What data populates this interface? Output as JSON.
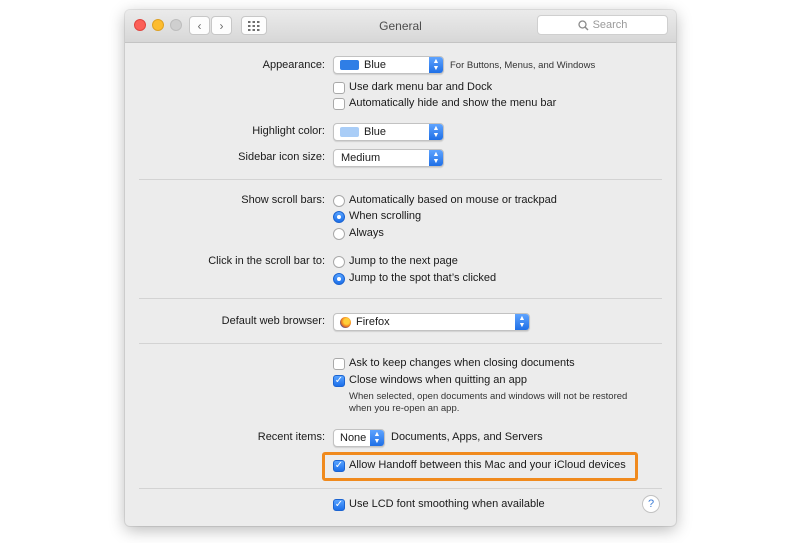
{
  "window": {
    "title": "General"
  },
  "toolbar": {
    "back_glyph": "‹",
    "forward_glyph": "›",
    "grid_glyph": "⋮⋮⋮"
  },
  "search": {
    "placeholder": "Search",
    "icon": "search-icon"
  },
  "appearance": {
    "label": "Appearance:",
    "value": "Blue",
    "note": "For Buttons, Menus, and Windows",
    "swatch_color": "#2f7ee6",
    "dark_menu": {
      "label": "Use dark menu bar and Dock",
      "checked": false
    },
    "auto_hide": {
      "label": "Automatically hide and show the menu bar",
      "checked": false
    }
  },
  "highlight_color": {
    "label": "Highlight color:",
    "value": "Blue",
    "swatch_color": "#a9cdf7"
  },
  "sidebar_icon_size": {
    "label": "Sidebar icon size:",
    "value": "Medium"
  },
  "scroll_bars": {
    "label": "Show scroll bars:",
    "options": [
      "Automatically based on mouse or trackpad",
      "When scrolling",
      "Always"
    ],
    "selected": "When scrolling"
  },
  "scroll_click": {
    "label": "Click in the scroll bar to:",
    "options": [
      "Jump to the next page",
      "Jump to the spot that’s clicked"
    ],
    "selected": "Jump to the spot that’s clicked"
  },
  "browser": {
    "label": "Default web browser:",
    "value": "Firefox",
    "icon": "firefox-icon"
  },
  "documents": {
    "ask_keep": {
      "label": "Ask to keep changes when closing documents",
      "checked": false
    },
    "close_windows": {
      "label": "Close windows when quitting an app",
      "checked": true
    },
    "note_line1": "When selected, open documents and windows will not be restored",
    "note_line2": "when you re-open an app."
  },
  "recent_items": {
    "label": "Recent items:",
    "value": "None",
    "suffix": "Documents, Apps, and Servers"
  },
  "handoff": {
    "label": "Allow Handoff between this Mac and your iCloud devices",
    "checked": true,
    "highlight_color": "#f08a1d"
  },
  "lcd": {
    "label": "Use LCD font smoothing when available",
    "checked": true
  },
  "help": {
    "glyph": "?"
  }
}
